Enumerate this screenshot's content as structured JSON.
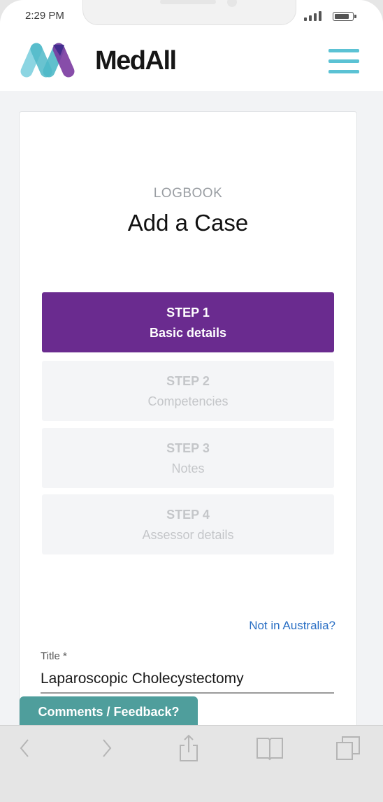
{
  "status_bar": {
    "time": "2:29 PM"
  },
  "header": {
    "brand": "MedAll",
    "logo_colors": [
      "#86d3e0",
      "#4fb9c8",
      "#3c2a8c",
      "#7a3aa0"
    ],
    "menu_icon": "hamburger-menu-icon",
    "menu_color": "#5bc2d4"
  },
  "page": {
    "eyebrow": "LOGBOOK",
    "title": "Add a Case"
  },
  "steps": [
    {
      "number": "STEP 1",
      "name": "Basic details",
      "active": true
    },
    {
      "number": "STEP 2",
      "name": "Competencies",
      "active": false
    },
    {
      "number": "STEP 3",
      "name": "Notes",
      "active": false
    },
    {
      "number": "STEP 4",
      "name": "Assessor details",
      "active": false
    }
  ],
  "accent_color": "#6a2b8f",
  "form": {
    "region_link": "Not in Australia?",
    "title_label": "Title *",
    "title_value": "Laparoscopic Cholecystectomy"
  },
  "feedback": {
    "label": "Comments / Feedback?",
    "color": "#4f9e9c"
  },
  "browser_toolbar": {
    "icons": [
      "back-icon",
      "forward-icon",
      "share-icon",
      "bookmarks-icon",
      "tabs-icon"
    ]
  }
}
